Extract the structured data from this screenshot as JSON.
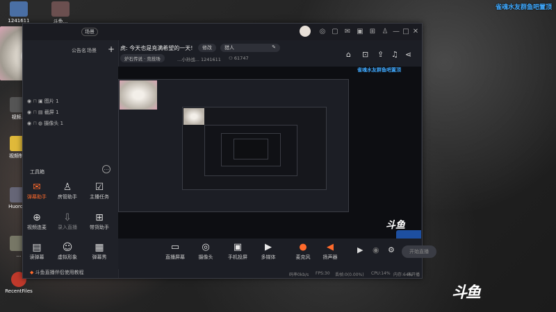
{
  "overlay_text": "雀魂水友群鱼吧置顶",
  "watermark": "斗鱼",
  "desktop": {
    "icons": [
      {
        "label": "1241611"
      },
      {
        "label": "斗鱼..."
      },
      {
        "label": "视频..."
      },
      {
        "label": "视频制作"
      },
      {
        "label": "Huorong"
      },
      {
        "label": "..."
      },
      {
        "label": "RecentFiles"
      }
    ]
  },
  "window": {
    "tag": "场景",
    "titlebar_buttons": [
      "headset-icon",
      "chat-icon",
      "mail-icon",
      "mail-icon",
      "grid-icon",
      "shirt-icon",
      "minimize-icon",
      "maximize-icon",
      "close-icon"
    ],
    "announcement": "虎: 今天也是充满希望的一天!",
    "edit_button": "修改",
    "category": "猎人",
    "game_tag": "炉石传说 · 竞技场",
    "room_info": "...小孙战... 1241611",
    "online_count": "61747",
    "left_tabs": [
      "公告名",
      "场景"
    ],
    "sources": [
      {
        "name": "图片 1"
      },
      {
        "name": "截屏 1"
      },
      {
        "name": "摄像头 1"
      }
    ],
    "toolbox_title": "工具箱",
    "tools": [
      {
        "label": "弹幕助手",
        "icon": "danmu-icon",
        "highlight": true
      },
      {
        "label": "房管助手",
        "icon": "user-icon"
      },
      {
        "label": "主播任务",
        "icon": "task-icon"
      },
      {
        "label": "视频连麦",
        "icon": "video-link-icon"
      },
      {
        "label": "录入直播",
        "icon": "download-icon"
      },
      {
        "label": "带货助手",
        "icon": "shop-icon"
      },
      {
        "label": "读弹幕",
        "icon": "read-icon"
      },
      {
        "label": "虚拟形象",
        "icon": "avatar-icon"
      },
      {
        "label": "弹幕秀",
        "icon": "show-icon"
      }
    ],
    "tutorial_link": "斗鱼直播伴侣使用教程",
    "bottom_buttons": [
      {
        "label": "直播屏幕",
        "icon": "screen-icon"
      },
      {
        "label": "摄像头",
        "icon": "camera-icon"
      },
      {
        "label": "手机投屏",
        "icon": "phone-icon"
      },
      {
        "label": "多媒体",
        "icon": "media-icon"
      },
      {
        "label": "麦克风",
        "icon": "mic-icon"
      },
      {
        "label": "扬声器",
        "icon": "speaker-icon"
      }
    ],
    "start_button": "开始直播",
    "status": {
      "bitrate": "码率0kb/s",
      "fps": "FPS:30",
      "dropped": "丢帧:0(0.00%)",
      "cpu": "CPU:14%",
      "memory": "内存:64%",
      "live_state": "未开播"
    }
  },
  "colors": {
    "accent_orange": "#ff6a2b",
    "overlay_blue": "#3fa9ff",
    "window_bg": "#1c1e25"
  }
}
